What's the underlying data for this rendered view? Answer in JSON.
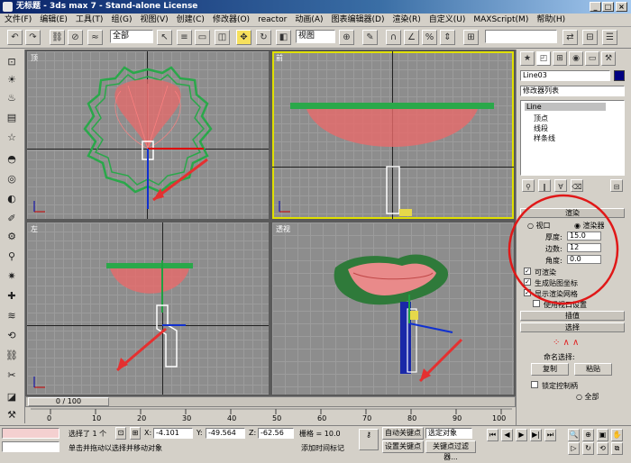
{
  "window": {
    "title": "无标题 - 3ds max 7 - Stand-alone License"
  },
  "menus": [
    "文件(F)",
    "编辑(E)",
    "工具(T)",
    "组(G)",
    "视图(V)",
    "创建(C)",
    "修改器(O)",
    "reactor",
    "动画(A)",
    "图表编辑器(D)",
    "渲染(R)",
    "自定义(U)",
    "MAXScript(M)",
    "帮助(H)"
  ],
  "toolbar": {
    "selection_filter": "全部",
    "ref_coord": "视图",
    "named_selection": ""
  },
  "viewports": {
    "top": "顶",
    "front": "前",
    "left": "左",
    "persp": "透视"
  },
  "timeline": {
    "frame_label": "0 / 100",
    "ticks": [
      "0",
      "10",
      "20",
      "30",
      "40",
      "50",
      "60",
      "70",
      "80",
      "90",
      "100"
    ]
  },
  "status": {
    "selected": "选择了 1 个",
    "x": "-4.101",
    "y": "-49.564",
    "z": "-62.56",
    "grid": "栅格 = 10.0",
    "auto_key": "自动关键点",
    "set_key": "设置关键点",
    "key_filters": "关键点过滤器...",
    "selected_sel": "选定对象",
    "prompt": "单击并拖动以选择并移动对象",
    "add_time_tag": "添加时间标记",
    "x_label": "X:",
    "y_label": "Y:",
    "z_label": "Z:"
  },
  "command_panel": {
    "object_name": "Line03",
    "modifier_list": "修改器列表",
    "stack": {
      "root": "Line",
      "items": [
        "顶点",
        "线段",
        "样条线"
      ]
    },
    "render_rollout": {
      "header": "渲染",
      "radio_viewport": "视口",
      "radio_render": "渲染器",
      "thickness_label": "厚度:",
      "thickness": "15.0",
      "sides_label": "边数:",
      "sides": "12",
      "angle_label": "角度:",
      "angle": "0.0",
      "renderable": "可渲染",
      "gen_mapping": "生成贴图坐标",
      "display_render_mesh": "显示渲染网格",
      "use_viewport": "使用视口设置"
    },
    "interp_header": "插值",
    "selection_header": "选择",
    "named_sel_label": "命名选择:",
    "copy_btn": "复制",
    "paste_btn": "粘贴",
    "lock_handles": "锁定控制柄",
    "all_label": "全部"
  },
  "colors": {
    "accent": "#f6e05c",
    "viewport_bg": "#8d8d8d",
    "title_bar": "#0a246a"
  }
}
